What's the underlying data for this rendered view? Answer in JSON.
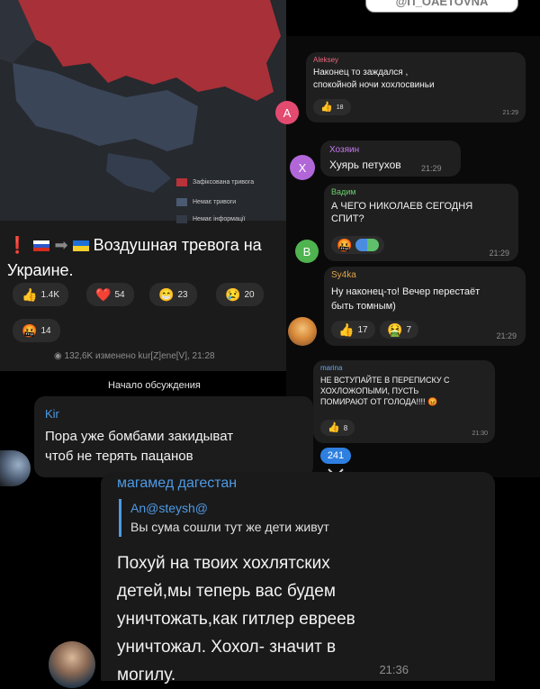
{
  "watermark": "@Π_OAETOVNA",
  "map_post": {
    "legend": [
      "Зафіксована тривога",
      "Немає тривоги",
      "Немає інформації"
    ],
    "legend_colors": [
      "#b8323a",
      "#4a5a72",
      "#333a46"
    ],
    "alert_text": "Воздушная тревога на Украине.",
    "reactions": [
      {
        "icon": "👍",
        "count": "1.4K"
      },
      {
        "icon": "❤️",
        "count": "54"
      },
      {
        "icon": "😁",
        "count": "23"
      },
      {
        "icon": "😢",
        "count": "20"
      },
      {
        "icon": "🤬",
        "count": "14"
      }
    ],
    "footer": "◉ 132,6K изменено kur[Z]ene[V], 21:28"
  },
  "discussion_label": "Начало обсуждения",
  "kir_message": {
    "name": "Kir",
    "text_line1": "Пора уже бомбами закидыват",
    "text_line2": "чтоб не терять пацанов"
  },
  "unread_count": "241",
  "right_comments": [
    {
      "name": "Aleksey",
      "avatar_letter": "A",
      "line1": "Наконец то заждался ,",
      "line2": "спокойной ночи хохлосвиньи",
      "react": "👍",
      "react_count": "18",
      "time": "21:29"
    },
    {
      "name": "Хозяин",
      "avatar_letter": "Х",
      "line1": "Хуярь петухов",
      "time": "21:29"
    },
    {
      "name": "Вадим",
      "avatar_letter": "В",
      "line1": "А ЧЕГО НИКОЛАЕВ СЕГОДНЯ",
      "line2": "СПИТ?",
      "react": "🤬",
      "time": "21:29"
    },
    {
      "name": "Sy4ka",
      "line1": "Ну наконец-то! Вечер перестаёт",
      "line2": "быть томным)",
      "react": "👍",
      "react_count": "17",
      "react2": "🤮",
      "react2_count": "7",
      "time": "21:29"
    },
    {
      "name": "marina",
      "line1": "НЕ ВСТУПАЙТЕ В ПЕРЕПИСКУ С",
      "line2": "ХОХЛОЖОПЫМИ, ПУСТЬ",
      "line3": "ПОМИРАЮТ ОТ ГОЛОДА!!!! 😡",
      "react": "👍",
      "react_count": "8",
      "time": "21:30"
    }
  ],
  "bottom_message": {
    "name": "магамед дагестан",
    "reply_name": "An@steysh@",
    "reply_text": "Вы сума сошли тут же дети живут",
    "lines": [
      "Похуй на твоих хохлятских",
      "детей,мы теперь вас будем",
      "уничтожать,как гитлер евреев",
      "уничтожал. Хохол- значит в",
      "могилу."
    ],
    "time": "21:36"
  }
}
